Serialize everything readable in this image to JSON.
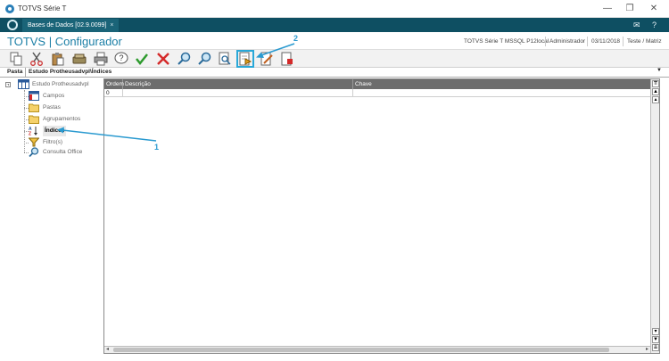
{
  "window": {
    "title": "TOTVS Série T",
    "controls": [
      "—",
      "❐",
      "✕"
    ]
  },
  "tabs": [
    {
      "label": "Bases de Dados [02.9.0099]",
      "close": "×"
    }
  ],
  "header": {
    "app_title": "TOTVS | Configurador",
    "environment": "TOTVS Série T  MSSQL P12local",
    "user": "Administrador",
    "date": "03/11/2018",
    "company": "Teste / Matriz"
  },
  "toolbar": {
    "buttons": [
      "copy-icon",
      "cut-icon",
      "paste-icon",
      "database-icon",
      "printer-icon",
      "help-icon",
      "check-icon",
      "cancel-icon",
      "search-icon",
      "search-next-icon",
      "search-document-icon",
      "document-add-icon",
      "document-edit-icon",
      "document-delete-icon"
    ]
  },
  "breadcrumb": {
    "label": "Pasta",
    "path": "Estudo Protheusadvpl\\Índices"
  },
  "tree": {
    "root": "Estudo Protheusadvpl",
    "items": [
      {
        "label": "Campos",
        "icon": "table-icon"
      },
      {
        "label": "Pastas",
        "icon": "folder-icon"
      },
      {
        "label": "Agrupamentos",
        "icon": "folder-icon"
      },
      {
        "label": "Índices",
        "icon": "sort-az-icon",
        "selected": true
      },
      {
        "label": "Filtro(s)",
        "icon": "filter-icon"
      },
      {
        "label": "Consulta Office",
        "icon": "search-icon"
      }
    ]
  },
  "grid": {
    "columns": [
      "Ordem",
      "Descrição",
      "Chave"
    ],
    "rows": [
      [
        "0",
        "",
        ""
      ]
    ]
  },
  "callouts": [
    "1",
    "2"
  ]
}
